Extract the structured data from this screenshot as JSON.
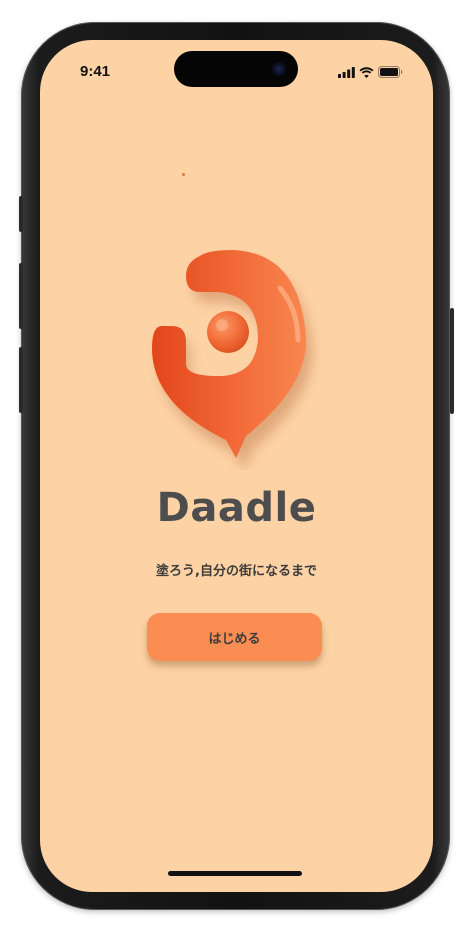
{
  "status_bar": {
    "time": "9:41",
    "icons": [
      "cellular-signal-icon",
      "wifi-icon",
      "battery-icon"
    ]
  },
  "app": {
    "name": "Daadle",
    "tagline": "塗ろう,自分の街になるまで",
    "start_button_label": "はじめる"
  },
  "colors": {
    "background": "#fdd2a5",
    "logo_primary": "#f26a38",
    "button": "#fb8d52",
    "text": "#4d4d4d"
  },
  "logo": {
    "icon": "daadle-pin-logo"
  }
}
